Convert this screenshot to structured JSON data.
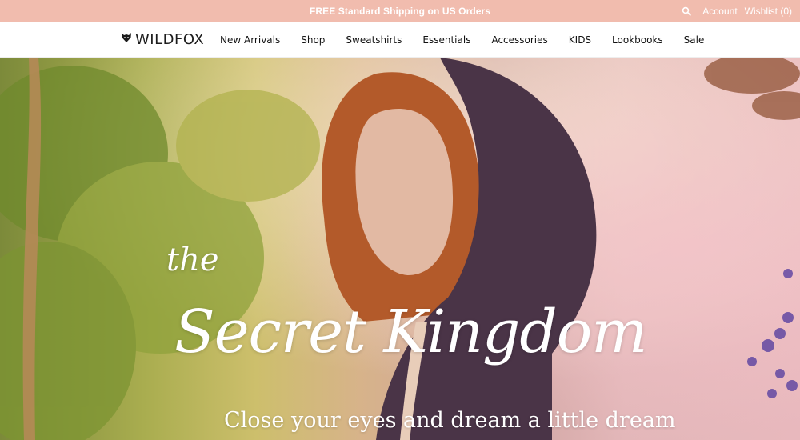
{
  "topbar": {
    "promo": "FREE Standard Shipping on US Orders",
    "account": "Account",
    "wishlist": "Wishlist (0)"
  },
  "logo": {
    "text": "WILDFOX"
  },
  "nav": {
    "items": [
      "New Arrivals",
      "Shop",
      "Sweatshirts",
      "Essentials",
      "Accessories",
      "KIDS",
      "Lookbooks",
      "Sale"
    ]
  },
  "hero": {
    "script_small": "the",
    "headline": "Secret Kingdom",
    "tagline": "Close your eyes and dream a little dream"
  },
  "colors": {
    "topbar_bg": "#f1bcae",
    "text_dark": "#111111",
    "hero_text": "#ffffff"
  },
  "icons": {
    "search": "search-icon",
    "logo_mark": "fox-head-icon"
  }
}
